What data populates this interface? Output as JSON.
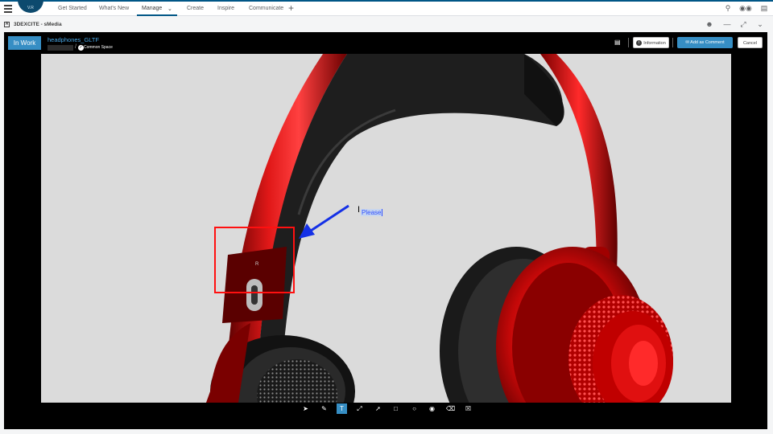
{
  "topbar": {
    "logo_text": "V.R",
    "tabs": [
      {
        "label": "Get Started"
      },
      {
        "label": "What's New"
      },
      {
        "label": "Manage"
      },
      {
        "label": "Create"
      },
      {
        "label": "Inspire"
      },
      {
        "label": "Communicate"
      }
    ],
    "active_tab": "Manage",
    "icons": [
      "search-icon",
      "tags-icon",
      "chat-icon"
    ]
  },
  "window": {
    "title": "3DEXCITE - sMedia",
    "icons": [
      "share-icon",
      "minimize-icon",
      "maximize-icon",
      "chevron-down-icon"
    ]
  },
  "viewer": {
    "status": "In Work",
    "document_title": "headphones_GLTF",
    "space": "Common Space",
    "buttons": {
      "information": "Information",
      "add_comment": "Add as Comment",
      "cancel": "Cancel"
    }
  },
  "annotation": {
    "text": "Please",
    "shape_label": "R",
    "arrow_color": "#1430e6",
    "rect_color": "#ff1010"
  },
  "toolbar": {
    "tools": [
      {
        "name": "select-tool-icon"
      },
      {
        "name": "pencil-tool-icon"
      },
      {
        "name": "text-tool-icon",
        "active": true
      },
      {
        "name": "line-tool-icon"
      },
      {
        "name": "arrow-tool-icon"
      },
      {
        "name": "rectangle-tool-icon"
      },
      {
        "name": "circle-tool-icon"
      },
      {
        "name": "palette-tool-icon"
      },
      {
        "name": "eraser-tool-icon"
      },
      {
        "name": "clear-tool-icon"
      }
    ],
    "accent": "#368ec4"
  }
}
